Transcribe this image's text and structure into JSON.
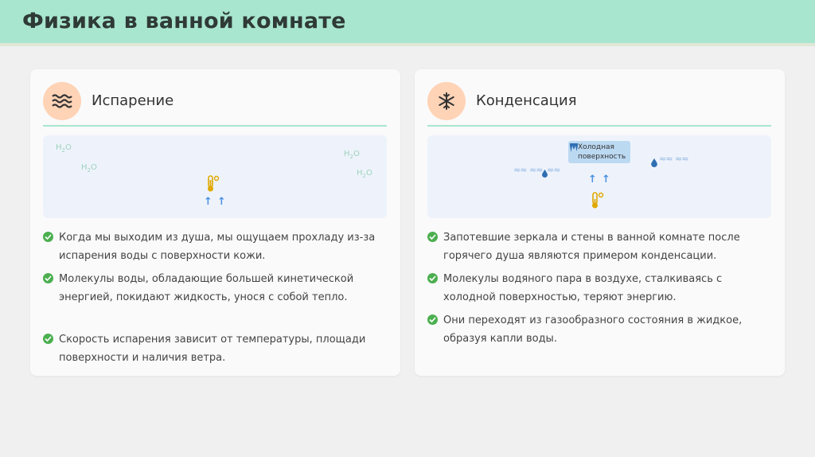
{
  "page": {
    "title": "Физика в ванной комнате"
  },
  "evaporation": {
    "title": "Испарение",
    "icon": "waves-icon",
    "molecules": [
      "H2O",
      "H2O",
      "H2O",
      "H2O"
    ],
    "points": [
      "Когда мы выходим из душа, мы ощущаем прохладу из-за испарения воды с поверхности кожи.",
      "Молекулы воды, обладающие большей кинетической энергией, покидают жидкость, унося с собой тепло.",
      "Скорость испарения зависит от температуры, площади поверхности и наличия ветра."
    ]
  },
  "condensation": {
    "title": "Конденсация",
    "icon": "snowflake-icon",
    "cold_label": "Холодная поверхность",
    "points": [
      "Запотевшие зеркала и стены в ванной комнате после горячего душа являются примером конденсации.",
      "Молекулы водяного пара в воздухе, сталкиваясь с холодной поверхностью, теряют энергию.",
      "Они переходят из газообразного состояния в жидкое, образуя капли воды."
    ]
  },
  "colors": {
    "header": "#a8e6cf",
    "accent": "#ffd3b6",
    "check": "#4caf50",
    "arrow": "#4a90e2"
  }
}
